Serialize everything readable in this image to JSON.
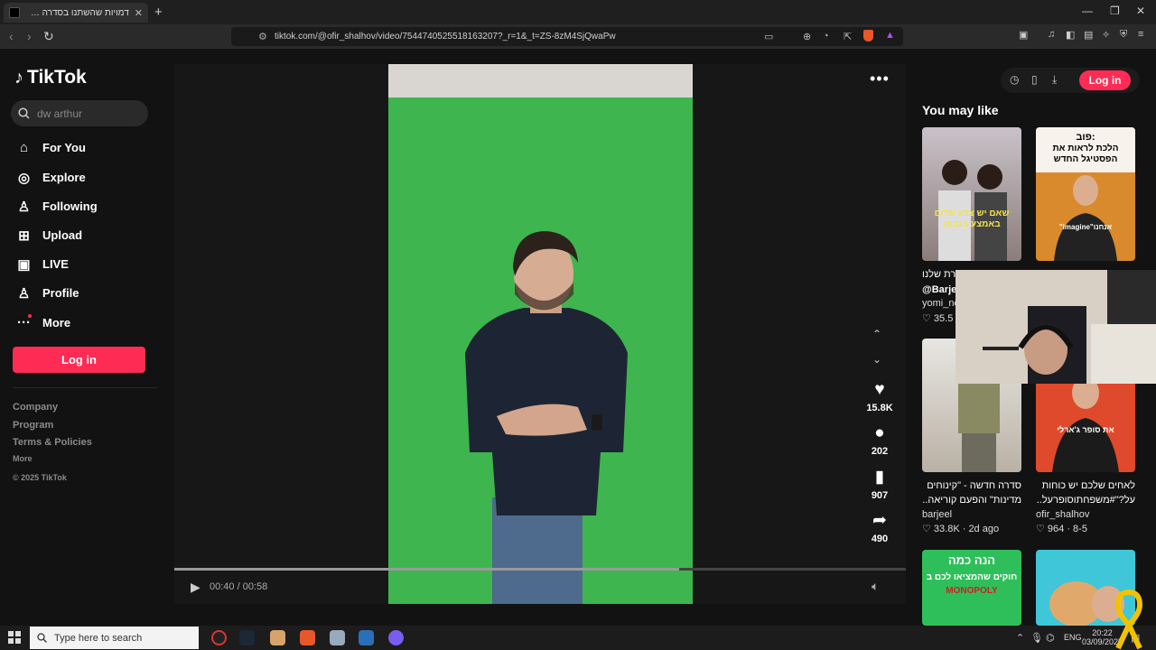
{
  "browser": {
    "tab_title": "דמויות שהשתנו בסדרה ארתור | ...",
    "url": "tiktok.com/@ofir_shalhov/video/7544740525518163207?_r=1&_t=ZS-8zM4SjQwaPw",
    "new_tab": "+",
    "close_tab": "✕"
  },
  "tiktok": {
    "logo": "TikTok",
    "search_value": "dw arthur",
    "nav": [
      {
        "label": "For You",
        "icon": "home-icon"
      },
      {
        "label": "Explore",
        "icon": "compass-icon"
      },
      {
        "label": "Following",
        "icon": "person-follow-icon"
      },
      {
        "label": "Upload",
        "icon": "plus-square-icon"
      },
      {
        "label": "LIVE",
        "icon": "tv-icon"
      },
      {
        "label": "Profile",
        "icon": "person-icon"
      },
      {
        "label": "More",
        "icon": "more-icon"
      }
    ],
    "login_label": "Log in",
    "footer": [
      "Company",
      "Program",
      "Terms & Policies",
      "More",
      "© 2025 TikTok"
    ],
    "accent_color": "#fe2c55"
  },
  "video": {
    "time": "00:40 / 00:58",
    "progress": 0.69,
    "likes": "15.8K",
    "comments": "202",
    "saves": "907",
    "shares": "490",
    "author": "ofir_shalhov"
  },
  "sidebar_right": {
    "login_label": "Log in",
    "heading": "You may like",
    "thumbs": [
      {
        "overlay": "שאם יש צבע אדום באמצע בגבות",
        "caption": "ורת שלנו",
        "caption2": "@Barje",
        "user": "yomi_ne",
        "meta": "♡ 35.5"
      },
      {
        "overlay_top": "פוב:",
        "overlay": "הלכת לראות את הפסטיגל החדש",
        "overlay_bottom": "\"imagine\"אנחנו",
        "caption": "",
        "caption2": "",
        "user": "",
        "meta": ""
      },
      {
        "overlay": "",
        "caption": "סדרה חדשה - \"קינוחים",
        "caption2": "מדינות\" והפעם קוריאה...",
        "user": "barjeel",
        "meta": "♡ 33.8K · 2d ago"
      },
      {
        "overlay": "את סופר ג'ארלי",
        "caption": "לאחים שלכם יש כוחות",
        "caption2": "על?\"#משפחתוסופרעל...",
        "user": "ofir_shalhov",
        "meta": "♡ 964 · 8-5"
      },
      {
        "overlay_top": "הנה כמה",
        "overlay": "חוקים שהמציאו לכם ב",
        "overlay_bottom": "MONOPOLY",
        "caption": "",
        "caption2": "",
        "user": "",
        "meta": ""
      },
      {
        "overlay": "",
        "caption": "",
        "caption2": "",
        "user": "",
        "meta": ""
      }
    ]
  },
  "taskbar": {
    "search_placeholder": "Type here to search",
    "lang": "ENG",
    "time": "20:22",
    "date": "03/09/2025"
  }
}
